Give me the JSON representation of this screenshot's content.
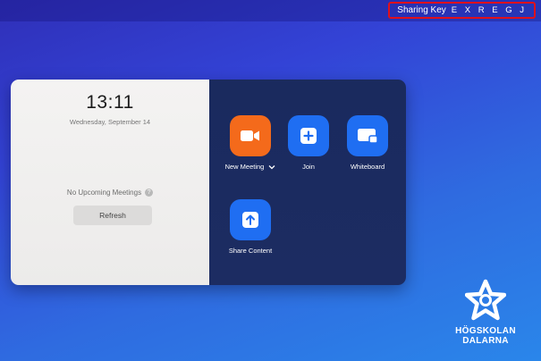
{
  "header": {
    "sharing_key_label": "Sharing Key",
    "sharing_key_value": "E X R E G J",
    "highlight_color": "#e0101c"
  },
  "left_panel": {
    "time": "13:11",
    "date": "Wednesday, September 14",
    "no_meetings_text": "No Upcoming Meetings",
    "help_icon": "?",
    "refresh_label": "Refresh"
  },
  "actions": {
    "new_meeting": {
      "label": "New Meeting",
      "icon": "video-camera-icon",
      "color": "#f46a1b"
    },
    "join": {
      "label": "Join",
      "icon": "plus-icon",
      "color": "#1f6ef2"
    },
    "whiteboard": {
      "label": "Whiteboard",
      "icon": "whiteboard-icon",
      "color": "#1f6ef2"
    },
    "share_content": {
      "label": "Share Content",
      "icon": "upload-arrow-icon",
      "color": "#1f6ef2"
    }
  },
  "logo": {
    "line1": "HÖGSKOLAN",
    "line2": "DALARNA"
  }
}
